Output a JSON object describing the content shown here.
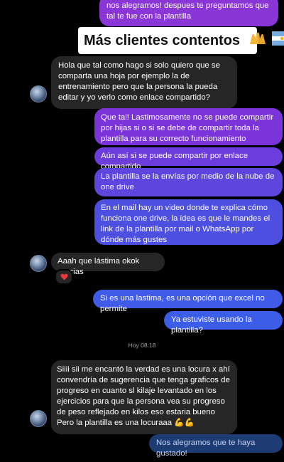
{
  "banner": {
    "text": "Más clientes contentos"
  },
  "messages": {
    "m0": "nos alegramos! despues te preguntamos que tal te fue con la plantilla",
    "m1": "Hola que tal como hago si solo quiero que se comparta una hoja por ejemplo la de entrenamiento pero que la persona la pueda editar y yo verlo como enlace compartido?",
    "m2": "Que tal! Lastimosamente no se puede compartir por hijas si o si se debe de compartir toda la plantilla para su correcto funcionamiento",
    "m3": "Aún así si se puede compartir por enlace compartido",
    "m4": "La plantilla se la envías por medio de la nube de one drive",
    "m5": "En el mail hay un video donde te explica cómo funciona one drive, la idea es que le mandes el link de la plantilla por mail o WhatsApp por dónde más gustes",
    "m6": "Aaah que lástima okok gracias",
    "m7": "Si es una lastima, es una opción que excel no permite",
    "m8": "Ya estuviste usando la plantilla?",
    "m9": "Siiii sii me encantó la verdad es una locura x ahí convendría de sugerencia que tenga graficos de progreso en cuanto sl kilaje levantado en los ejercicios para que la persona vea su progreso de peso reflejado en kilos eso estaria bueno",
    "m9b": "Pero la plantilla es una locuraaa 💪💪",
    "m10": "Nos alegramos que te haya gustado!"
  },
  "timestamp": "Hoy 08:18",
  "reaction": "❤️",
  "colors": {
    "them_bubble": "#262626",
    "me_gradient_top": "#7b2fd8",
    "me_gradient_bottom": "#3b55e6",
    "background": "#000000"
  },
  "icons": [
    "avatar",
    "raised-hands-emoji",
    "argentina-flag-emoji",
    "heart-reaction-icon",
    "flexed-biceps-emoji"
  ]
}
